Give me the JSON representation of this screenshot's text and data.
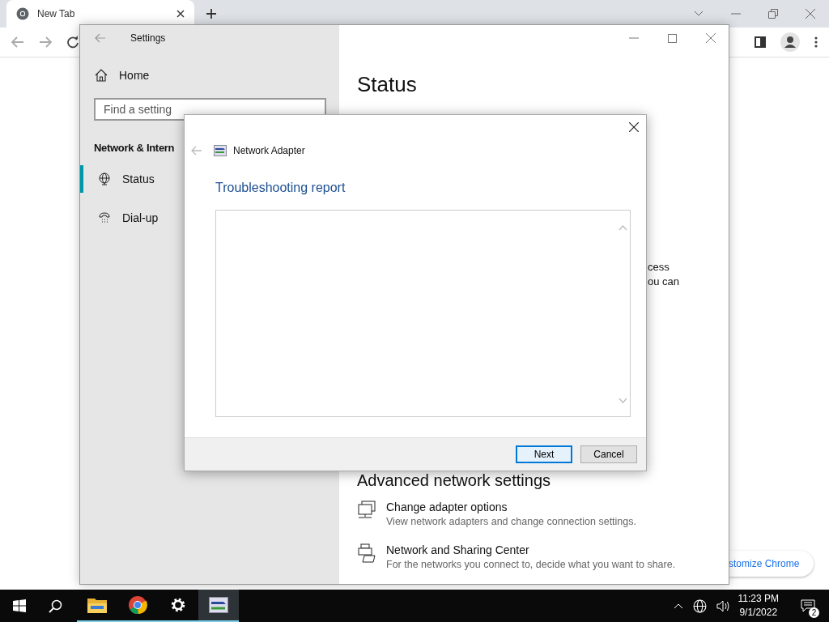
{
  "browser": {
    "tab": {
      "title": "New Tab"
    },
    "customize_button": "stomize Chrome"
  },
  "settings": {
    "title": "Settings",
    "home": "Home",
    "search": {
      "placeholder": "Find a setting"
    },
    "section": "Network & Intern",
    "nav": [
      {
        "label": "Status",
        "kind": "status",
        "selected": true
      },
      {
        "label": "Dial-up",
        "kind": "dialup",
        "selected": false
      }
    ],
    "heading": "Status",
    "fragments": [
      "cess",
      "ou can"
    ],
    "advanced_heading": "Advanced network settings",
    "links": [
      {
        "kind": "adapter",
        "title": "Change adapter options",
        "description": "View network adapters and change connection settings."
      },
      {
        "kind": "sharing",
        "title": "Network and Sharing Center",
        "description": "For the networks you connect to, decide what you want to share."
      }
    ]
  },
  "dialog": {
    "title": "Network Adapter",
    "heading": "Troubleshooting report",
    "buttons": [
      {
        "label": "Next",
        "focused": true
      },
      {
        "label": "Cancel",
        "focused": false
      }
    ]
  },
  "taskbar": {
    "apps": [
      {
        "kind": "explorer",
        "running": true,
        "selected": false
      },
      {
        "kind": "chrome",
        "running": true,
        "selected": false
      },
      {
        "kind": "settings",
        "running": true,
        "selected": false
      },
      {
        "kind": "troubleshooter",
        "running": true,
        "selected": true
      }
    ],
    "time": "11:23 PM",
    "date": "9/1/2022",
    "notifications": "2"
  }
}
